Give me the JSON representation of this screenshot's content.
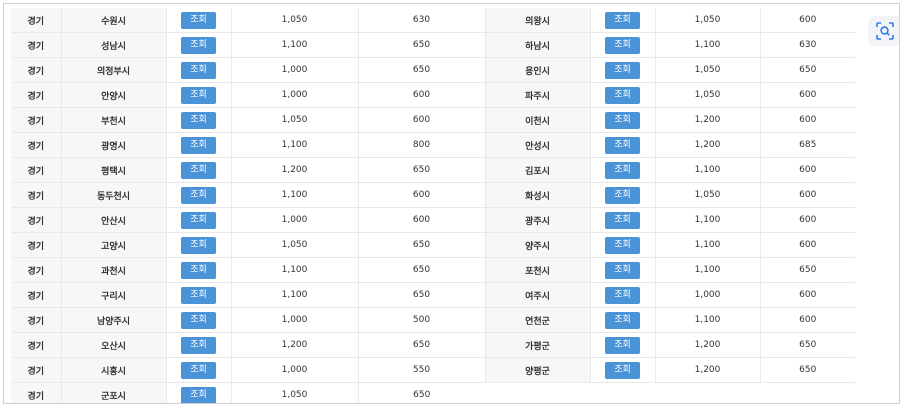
{
  "lookup_label": "조회",
  "rows": [
    {
      "left": {
        "region": "경기",
        "city": "수원시",
        "v1": "1,050",
        "v2": "630"
      },
      "right": {
        "city": "의왕시",
        "v1": "1,050",
        "v2": "600"
      }
    },
    {
      "left": {
        "region": "경기",
        "city": "성남시",
        "v1": "1,100",
        "v2": "650"
      },
      "right": {
        "city": "하남시",
        "v1": "1,100",
        "v2": "630"
      }
    },
    {
      "left": {
        "region": "경기",
        "city": "의정부시",
        "v1": "1,000",
        "v2": "650"
      },
      "right": {
        "city": "용인시",
        "v1": "1,050",
        "v2": "650"
      }
    },
    {
      "left": {
        "region": "경기",
        "city": "안양시",
        "v1": "1,000",
        "v2": "600"
      },
      "right": {
        "city": "파주시",
        "v1": "1,050",
        "v2": "600"
      }
    },
    {
      "left": {
        "region": "경기",
        "city": "부천시",
        "v1": "1,050",
        "v2": "600"
      },
      "right": {
        "city": "이천시",
        "v1": "1,200",
        "v2": "600"
      }
    },
    {
      "left": {
        "region": "경기",
        "city": "광명시",
        "v1": "1,100",
        "v2": "800"
      },
      "right": {
        "city": "안성시",
        "v1": "1,200",
        "v2": "685"
      }
    },
    {
      "left": {
        "region": "경기",
        "city": "평택시",
        "v1": "1,200",
        "v2": "650"
      },
      "right": {
        "city": "김포시",
        "v1": "1,100",
        "v2": "600"
      }
    },
    {
      "left": {
        "region": "경기",
        "city": "동두천시",
        "v1": "1,100",
        "v2": "600"
      },
      "right": {
        "city": "화성시",
        "v1": "1,050",
        "v2": "600"
      }
    },
    {
      "left": {
        "region": "경기",
        "city": "안산시",
        "v1": "1,000",
        "v2": "600"
      },
      "right": {
        "city": "광주시",
        "v1": "1,100",
        "v2": "600"
      }
    },
    {
      "left": {
        "region": "경기",
        "city": "고양시",
        "v1": "1,050",
        "v2": "650"
      },
      "right": {
        "city": "양주시",
        "v1": "1,100",
        "v2": "600"
      }
    },
    {
      "left": {
        "region": "경기",
        "city": "과천시",
        "v1": "1,100",
        "v2": "650"
      },
      "right": {
        "city": "포천시",
        "v1": "1,100",
        "v2": "650"
      }
    },
    {
      "left": {
        "region": "경기",
        "city": "구리시",
        "v1": "1,100",
        "v2": "650"
      },
      "right": {
        "city": "여주시",
        "v1": "1,000",
        "v2": "600"
      }
    },
    {
      "left": {
        "region": "경기",
        "city": "남양주시",
        "v1": "1,000",
        "v2": "500"
      },
      "right": {
        "city": "연천군",
        "v1": "1,100",
        "v2": "600"
      }
    },
    {
      "left": {
        "region": "경기",
        "city": "오산시",
        "v1": "1,200",
        "v2": "650"
      },
      "right": {
        "city": "가평군",
        "v1": "1,200",
        "v2": "650"
      }
    },
    {
      "left": {
        "region": "경기",
        "city": "시흥시",
        "v1": "1,000",
        "v2": "550"
      },
      "right": {
        "city": "양평군",
        "v1": "1,200",
        "v2": "650"
      }
    },
    {
      "left": {
        "region": "경기",
        "city": "군포시",
        "v1": "1,050",
        "v2": "650"
      },
      "right": null
    }
  ],
  "colors": {
    "button": "#4b93d7",
    "label_bg": "#f7f7f7",
    "number_text": "#888888",
    "scan_icon": "#2f7df0"
  },
  "icons": {
    "scan": "scan-lens-icon"
  }
}
